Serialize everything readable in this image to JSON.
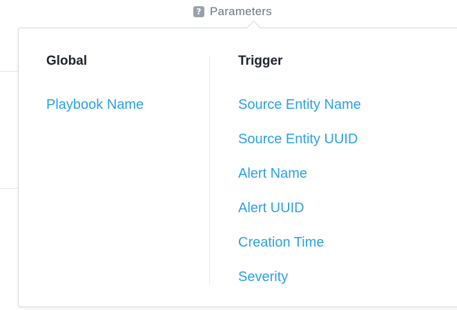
{
  "trigger": {
    "label": "Parameters",
    "icon": "help-icon",
    "icon_glyph": "?"
  },
  "popover": {
    "columns": [
      {
        "heading": "Global",
        "items": [
          "Playbook Name"
        ]
      },
      {
        "heading": "Trigger",
        "items": [
          "Source Entity Name",
          "Source Entity UUID",
          "Alert Name",
          "Alert UUID",
          "Creation Time",
          "Severity"
        ]
      }
    ]
  },
  "colors": {
    "link": "#2a9fe8",
    "heading": "#20252d",
    "muted": "#6b7380",
    "border": "#d4d8de"
  }
}
